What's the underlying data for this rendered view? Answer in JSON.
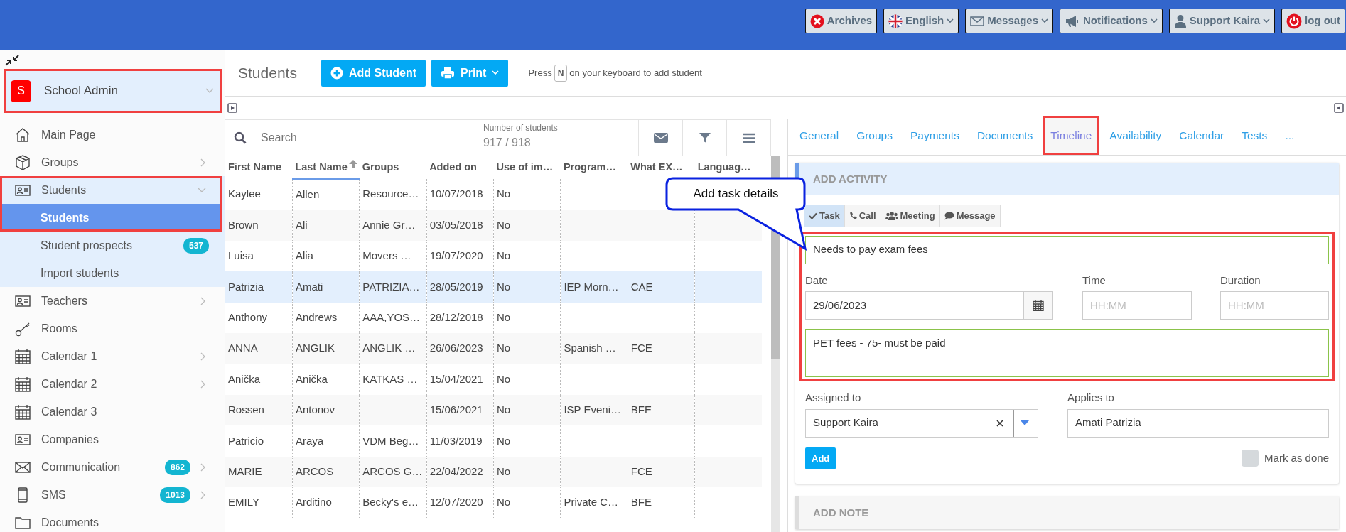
{
  "topbar": {
    "buttons": [
      {
        "label": "Archives",
        "dropdown": false
      },
      {
        "label": "English",
        "dropdown": true
      },
      {
        "label": "Messages",
        "dropdown": true
      },
      {
        "label": "Notifications",
        "dropdown": true
      },
      {
        "label": "Support Kaira",
        "dropdown": true
      },
      {
        "label": "log out",
        "dropdown": false
      }
    ]
  },
  "sidebar": {
    "header": {
      "initial": "S",
      "title": "School Admin",
      "highlighted": true
    },
    "items": [
      {
        "label": "Main Page",
        "has_submenu": false,
        "highlighted": false
      },
      {
        "label": "Groups",
        "has_submenu": true,
        "expanded": false,
        "highlighted": false
      },
      {
        "label": "Students",
        "has_submenu": true,
        "expanded": true,
        "highlighted": true,
        "children": [
          {
            "label": "Students",
            "selected": true
          },
          {
            "label": "Student prospects",
            "selected": false,
            "badge": "537"
          },
          {
            "label": "Import students",
            "selected": false
          }
        ]
      },
      {
        "label": "Teachers",
        "has_submenu": true,
        "expanded": false,
        "highlighted": false
      },
      {
        "label": "Rooms",
        "has_submenu": false,
        "highlighted": false
      },
      {
        "label": "Calendar 1",
        "has_submenu": true,
        "expanded": false,
        "highlighted": false
      },
      {
        "label": "Calendar 2",
        "has_submenu": true,
        "expanded": false,
        "highlighted": false
      },
      {
        "label": "Calendar 3",
        "has_submenu": false,
        "highlighted": false
      },
      {
        "label": "Companies",
        "has_submenu": false,
        "highlighted": false
      },
      {
        "label": "Communication",
        "has_submenu": true,
        "expanded": false,
        "highlighted": false,
        "badge": "862"
      },
      {
        "label": "SMS",
        "has_submenu": true,
        "expanded": false,
        "highlighted": false,
        "badge": "1013"
      },
      {
        "label": "Documents",
        "has_submenu": false,
        "highlighted": false
      }
    ]
  },
  "page": {
    "title": "Students",
    "buttons": [
      {
        "label": "Add Student",
        "dropdown": false
      },
      {
        "label": "Print",
        "dropdown": true
      }
    ],
    "hint": {
      "before": "Press",
      "key": "N",
      "after": "on your keyboard to add student"
    }
  },
  "table": {
    "search": {
      "placeholder": "Search"
    },
    "count_label": "Number of students",
    "count": "917 / 918",
    "columns": [
      {
        "label": "First Name",
        "sorted": false
      },
      {
        "label": "Last Name",
        "sorted": true
      },
      {
        "label": "Groups",
        "sorted": false
      },
      {
        "label": "Added on",
        "sorted": false
      },
      {
        "label": "Use of im…",
        "sorted": false
      },
      {
        "label": "Program…",
        "sorted": false
      },
      {
        "label": "What EX…",
        "sorted": false
      },
      {
        "label": "Languag…",
        "sorted": false
      }
    ],
    "rows": [
      {
        "selected": false,
        "cells": [
          "Kaylee",
          "Allen",
          "Resource…",
          "10/07/2018",
          "No",
          "",
          "",
          ""
        ]
      },
      {
        "selected": false,
        "cells": [
          "Brown",
          "Ali",
          "Annie Gr…",
          "03/05/2018",
          "No",
          "",
          "",
          ""
        ]
      },
      {
        "selected": false,
        "cells": [
          "Luisa",
          "Alia",
          "Movers …",
          "19/07/2020",
          "No",
          "",
          "",
          ""
        ]
      },
      {
        "selected": true,
        "cells": [
          "Patrizia",
          "Amati",
          "PATRIZIA…",
          "28/05/2019",
          "No",
          "IEP Morn…",
          "CAE",
          ""
        ]
      },
      {
        "selected": false,
        "cells": [
          "Anthony",
          "Andrews",
          "AAA,YOS…",
          "28/12/2018",
          "No",
          "",
          "",
          ""
        ]
      },
      {
        "selected": false,
        "cells": [
          "ANNA",
          "ANGLIK",
          "ANGLIK …",
          "26/06/2023",
          "No",
          "Spanish …",
          "FCE",
          ""
        ]
      },
      {
        "selected": false,
        "cells": [
          "Anička",
          "Anička",
          "KATKAS …",
          "15/04/2021",
          "No",
          "",
          "",
          ""
        ]
      },
      {
        "selected": false,
        "cells": [
          "Rossen",
          "Antonov",
          "",
          "15/06/2021",
          "No",
          "ISP Eveni…",
          "BFE",
          ""
        ]
      },
      {
        "selected": false,
        "cells": [
          "Patricio",
          "Araya",
          "VDM Beg…",
          "11/03/2019",
          "No",
          "",
          "",
          ""
        ]
      },
      {
        "selected": false,
        "cells": [
          "MARIE",
          "ARCOS",
          "ARCOS G…",
          "22/04/2022",
          "No",
          "",
          "FCE",
          ""
        ]
      },
      {
        "selected": false,
        "cells": [
          "EMILY",
          "Arditino",
          "Becky's e…",
          "12/07/2020",
          "No",
          "Private C…",
          "BFE",
          ""
        ]
      }
    ]
  },
  "detail": {
    "tabs": [
      {
        "label": "General",
        "selected": false,
        "highlighted": false
      },
      {
        "label": "Groups",
        "selected": false,
        "highlighted": false
      },
      {
        "label": "Payments",
        "selected": false,
        "highlighted": false
      },
      {
        "label": "Documents",
        "selected": false,
        "highlighted": false
      },
      {
        "label": "Timeline",
        "selected": true,
        "highlighted": true
      },
      {
        "label": "Availability",
        "selected": false,
        "highlighted": false
      },
      {
        "label": "Calendar",
        "selected": false,
        "highlighted": false
      },
      {
        "label": "Tests",
        "selected": false,
        "highlighted": false
      },
      {
        "label": "...",
        "selected": false,
        "highlighted": false
      }
    ],
    "activity": {
      "title": "ADD ACTIVITY",
      "types": [
        {
          "label": "Task",
          "selected": true
        },
        {
          "label": "Call",
          "selected": false
        },
        {
          "label": "Meeting",
          "selected": false
        },
        {
          "label": "Message",
          "selected": false
        }
      ],
      "highlighted": true,
      "subject": "Needs to pay exam fees",
      "date_label": "Date",
      "date": "29/06/2023",
      "time_label": "Time",
      "time_placeholder": "HH:MM",
      "duration_label": "Duration",
      "duration_placeholder": "HH:MM",
      "notes": "PET fees - 75- must be paid",
      "assigned_label": "Assigned to",
      "assigned": "Support Kaira",
      "applies_label": "Applies to",
      "applies": "Amati Patrizia",
      "add_button": "Add",
      "done_label": "Mark as done",
      "done": false
    },
    "note_title": "ADD NOTE"
  },
  "callout": {
    "text": "Add task details"
  }
}
